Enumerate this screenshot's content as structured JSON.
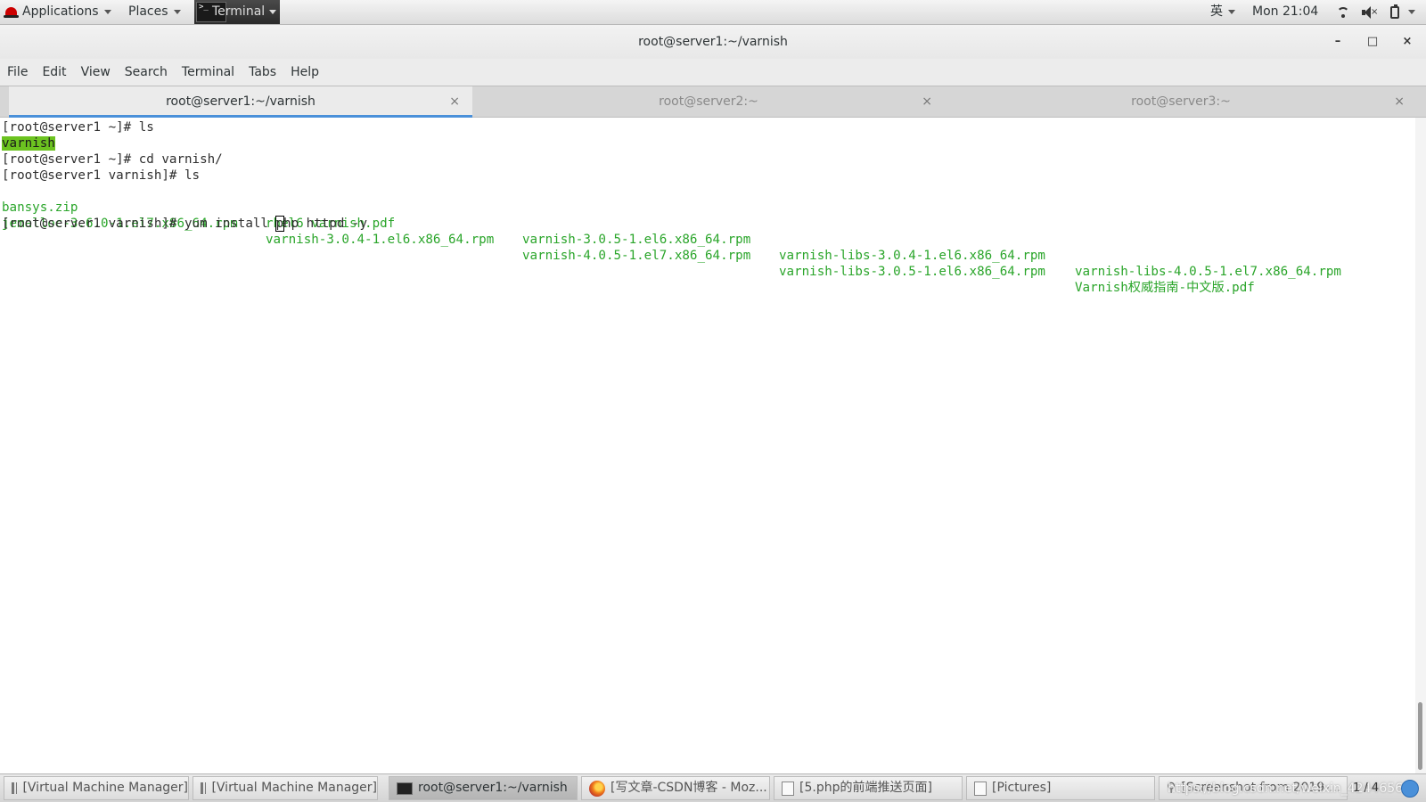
{
  "top_panel": {
    "applications": "Applications",
    "places": "Places",
    "terminal_task": "Terminal",
    "input_method": "英",
    "clock": "Mon 21:04"
  },
  "window": {
    "title": "root@server1:~/varnish",
    "minimize": "–",
    "maximize": "□",
    "close": "×"
  },
  "menubar": [
    "File",
    "Edit",
    "View",
    "Search",
    "Terminal",
    "Tabs",
    "Help"
  ],
  "tabs": [
    {
      "label": "root@server1:~/varnish",
      "active": true
    },
    {
      "label": "root@server2:~",
      "active": false
    },
    {
      "label": "root@server3:~",
      "active": false
    }
  ],
  "tab_close": "×",
  "terminal": {
    "prompt1": "[root@server1 ~]# ls",
    "ls1": "varnish",
    "prompt2": "[root@server1 ~]# cd varnish/",
    "prompt3": "[root@server1 varnish]# ls",
    "files_row1": [
      "bansys.zip",
      "rhel6 varnish.pdf",
      "varnish-3.0.5-1.el6.x86_64.rpm",
      "varnish-libs-3.0.4-1.el6.x86_64.rpm",
      "varnish-libs-4.0.5-1.el7.x86_64.rpm"
    ],
    "files_row2": [
      "jemalloc-3.6.0-1.el7.x86_64.rpm",
      "varnish-3.0.4-1.el6.x86_64.rpm",
      "varnish-4.0.5-1.el7.x86_64.rpm",
      "varnish-libs-3.0.5-1.el6.x86_64.rpm",
      "Varnish权威指南-中文版.pdf"
    ],
    "prompt4_before": "[root@server1 varnish]# yum install ",
    "prompt4_cursor": "p",
    "prompt4_after": "hp httpd -y"
  },
  "taskbar": {
    "items": [
      {
        "label": "[Virtual Machine Manager]",
        "icon": "vm-icon"
      },
      {
        "label": "[Virtual Machine Manager]",
        "icon": "vm-icon"
      },
      {
        "label": "root@server1:~/varnish",
        "icon": "terminal-icon"
      },
      {
        "label": "[写文章-CSDN博客 - Moz...",
        "icon": "firefox-icon"
      },
      {
        "label": "[5.php的前端推送页面]",
        "icon": "image-icon"
      },
      {
        "label": "[Pictures]",
        "icon": "image-icon"
      },
      {
        "label": "[Screenshot from 2019-...",
        "icon": "search-icon"
      }
    ],
    "workspace": "1 / 4",
    "watermark": "https://blog.csdn.net/weixin_42446569"
  },
  "colors": {
    "terminal_green": "#2aa52a",
    "highlight_green": "#6cc320",
    "active_tab_underline": "#4a90d9"
  }
}
